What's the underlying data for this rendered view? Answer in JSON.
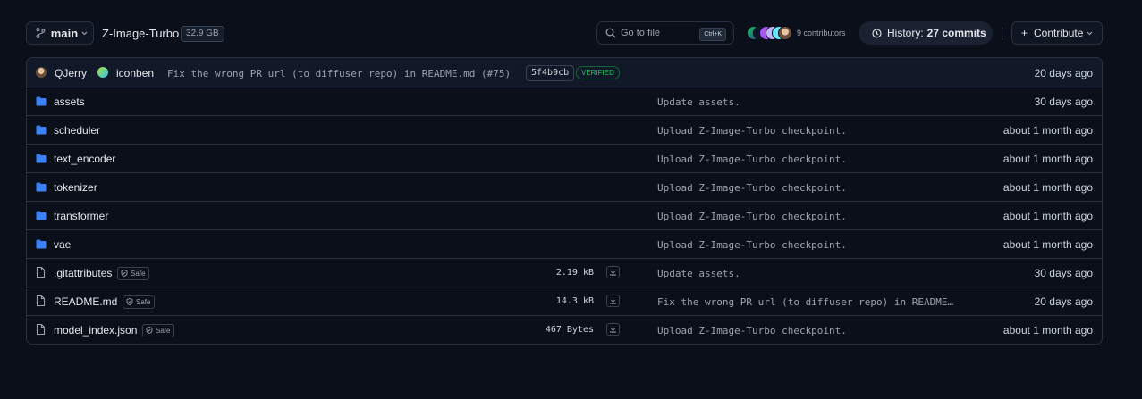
{
  "header": {
    "branch": "main",
    "repo_name": "Z-Image-Turbo",
    "repo_size": "32.9 GB",
    "goto_placeholder": "Go to file",
    "goto_shortcut": "Ctrl+K",
    "contributors": "9 contributors",
    "history_label": "History:",
    "history_commits": "27 commits",
    "contribute_label": "Contribute"
  },
  "last_commit": {
    "author1": "QJerry",
    "author2": "iconben",
    "message": "Fix the wrong PR url (to diffuser repo) in README.md (#75)",
    "hash": "5f4b9cb",
    "verified": "VERIFIED",
    "time": "20 days ago"
  },
  "rows": [
    {
      "type": "folder",
      "name": "assets",
      "commit": "Update assets.",
      "time": "30 days ago"
    },
    {
      "type": "folder",
      "name": "scheduler",
      "commit": "Upload Z-Image-Turbo checkpoint.",
      "time": "about 1 month ago"
    },
    {
      "type": "folder",
      "name": "text_encoder",
      "commit": "Upload Z-Image-Turbo checkpoint.",
      "time": "about 1 month ago"
    },
    {
      "type": "folder",
      "name": "tokenizer",
      "commit": "Upload Z-Image-Turbo checkpoint.",
      "time": "about 1 month ago"
    },
    {
      "type": "folder",
      "name": "transformer",
      "commit": "Upload Z-Image-Turbo checkpoint.",
      "time": "about 1 month ago"
    },
    {
      "type": "folder",
      "name": "vae",
      "commit": "Upload Z-Image-Turbo checkpoint.",
      "time": "about 1 month ago"
    },
    {
      "type": "file",
      "name": ".gitattributes",
      "safe": "Safe",
      "size": "2.19 kB",
      "commit": "Update assets.",
      "time": "30 days ago"
    },
    {
      "type": "file",
      "name": "README.md",
      "safe": "Safe",
      "size": "14.3 kB",
      "commit": "Fix the wrong PR url (to diffuser repo) in README…",
      "time": "20 days ago"
    },
    {
      "type": "file",
      "name": "model_index.json",
      "safe": "Safe",
      "size": "467 Bytes",
      "commit": "Upload Z-Image-Turbo checkpoint.",
      "time": "about 1 month ago"
    }
  ],
  "colors": {
    "background": "#0b0f19",
    "folder": "#3b82f6",
    "verified": "#22c55e",
    "border": "#273142"
  },
  "icons": {
    "branch": "git-branch-icon",
    "search": "search-icon",
    "history": "clock-icon",
    "folder": "folder-icon",
    "file": "file-icon",
    "download": "download-icon",
    "safe": "shield-icon"
  }
}
